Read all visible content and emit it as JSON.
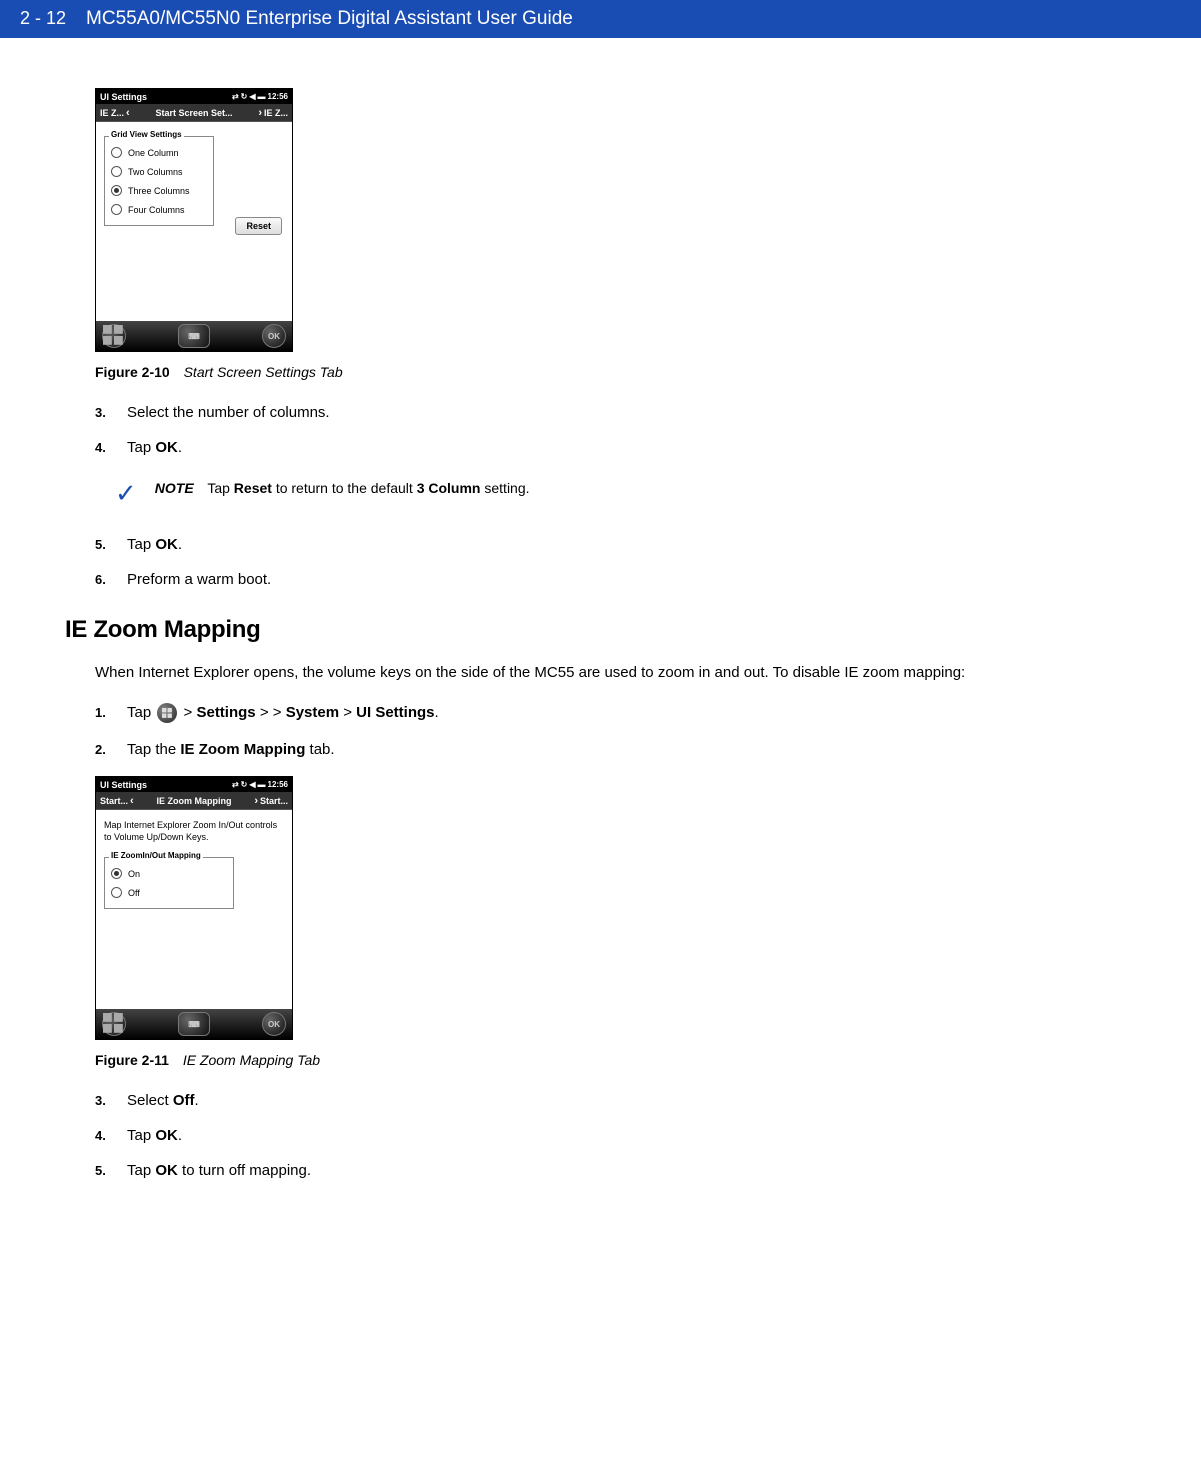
{
  "header": {
    "page_number": "2 - 12",
    "title": "MC55A0/MC55N0 Enterprise Digital Assistant User Guide"
  },
  "figure1": {
    "label": "Figure 2-10",
    "title": "Start Screen Settings Tab",
    "device": {
      "status_title": "UI Settings",
      "time": "12:56",
      "tab_left": "IE Z...",
      "tab_center": "Start Screen Set...",
      "tab_right": "IE Z...",
      "fieldset_legend": "Grid View Settings",
      "options": [
        {
          "label": "One Column",
          "selected": false
        },
        {
          "label": "Two Columns",
          "selected": false
        },
        {
          "label": "Three Columns",
          "selected": true
        },
        {
          "label": "Four Columns",
          "selected": false
        }
      ],
      "reset_button": "Reset",
      "ok_button": "OK"
    }
  },
  "steps_a": {
    "s3": {
      "num": "3.",
      "text_a": "Select the number of columns."
    },
    "s4": {
      "num": "4.",
      "text_a": "Tap ",
      "bold": "OK",
      "text_b": "."
    }
  },
  "note": {
    "label": "NOTE",
    "text_a": "Tap ",
    "bold_a": "Reset",
    "text_b": " to return to the default ",
    "bold_b": "3 Column",
    "text_c": " setting."
  },
  "steps_b": {
    "s5": {
      "num": "5.",
      "text_a": "Tap ",
      "bold": "OK",
      "text_b": "."
    },
    "s6": {
      "num": "6.",
      "text_a": "Preform a warm boot."
    }
  },
  "section2": {
    "heading": "IE Zoom Mapping",
    "intro": "When Internet Explorer opens, the volume keys on the side of the MC55 are used to zoom in and out. To disable IE zoom mapping:"
  },
  "steps_c": {
    "s1": {
      "num": "1.",
      "text_a": "Tap ",
      "text_b": " > ",
      "bold_a": "Settings",
      "text_c": " > > ",
      "bold_b": "System",
      "text_d": " > ",
      "bold_c": "UI Settings",
      "text_e": "."
    },
    "s2": {
      "num": "2.",
      "text_a": "Tap the ",
      "bold": "IE Zoom Mapping",
      "text_b": " tab."
    }
  },
  "figure2": {
    "label": "Figure 2-11",
    "title": "IE Zoom Mapping Tab",
    "device": {
      "status_title": "UI Settings",
      "time": "12:56",
      "tab_left": "Start...",
      "tab_center": "IE Zoom Mapping",
      "tab_right": "Start...",
      "body_text": "Map Internet Explorer Zoom In/Out controls to Volume Up/Down Keys.",
      "fieldset_legend": "IE ZoomIn/Out Mapping",
      "options": [
        {
          "label": "On",
          "selected": true
        },
        {
          "label": "Off",
          "selected": false
        }
      ],
      "ok_button": "OK"
    }
  },
  "steps_d": {
    "s3": {
      "num": "3.",
      "text_a": "Select ",
      "bold": "Off",
      "text_b": "."
    },
    "s4": {
      "num": "4.",
      "text_a": "Tap ",
      "bold": "OK",
      "text_b": "."
    },
    "s5": {
      "num": "5.",
      "text_a": "Tap ",
      "bold": "OK",
      "text_b": " to turn off mapping."
    }
  }
}
